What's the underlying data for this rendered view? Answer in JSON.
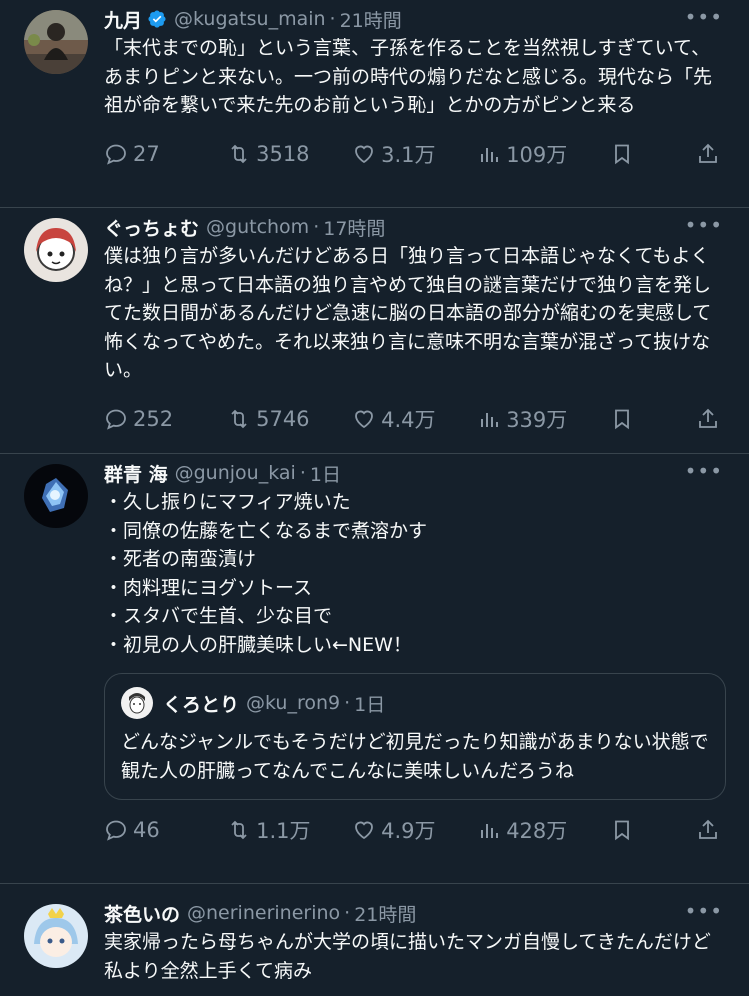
{
  "tweets": [
    {
      "name": "九月",
      "handle": "@kugatsu_main",
      "time": "21時間",
      "text": "「末代までの恥」という言葉、子孫を作ることを当然視しすぎていて、あまりピンと来ない。一つ前の時代の煽りだなと感じる。現代なら「先祖が命を繋いで来た先のお前という恥」とかの方がピンと来る",
      "replies": "27",
      "retweets": "3518",
      "likes": "3.1万",
      "views": "109万"
    },
    {
      "name": "ぐっちょむ",
      "handle": "@gutchom",
      "time": "17時間",
      "text": "僕は独り言が多いんだけどある日「独り言って日本語じゃなくてもよくね？」と思って日本語の独り言やめて独自の謎言葉だけで独り言を発してた数日間があるんだけど急速に脳の日本語の部分が縮むのを実感して怖くなってやめた。それ以来独り言に意味不明な言葉が混ざって抜けない。",
      "replies": "252",
      "retweets": "5746",
      "likes": "4.4万",
      "views": "339万"
    },
    {
      "name": "群青 海",
      "handle": "@gunjou_kai",
      "time": "1日",
      "text": "・久し振りにマフィア焼いた\n・同僚の佐藤を亡くなるまで煮溶かす\n・死者の南蛮漬け\n・肉料理にヨグソトース\n・スタバで生首、少な目で\n・初見の人の肝臓美味しい←NEW！",
      "quote": {
        "name": "くろとり",
        "handle": "@ku_ron9",
        "time": "1日",
        "text": "どんなジャンルでもそうだけど初見だったり知識があまりない状態で観た人の肝臓ってなんでこんなに美味しいんだろうね"
      },
      "replies": "46",
      "retweets": "1.1万",
      "likes": "4.9万",
      "views": "428万"
    },
    {
      "name": "茶色いの",
      "handle": "@nerinerinerino",
      "time": "21時間",
      "text": "実家帰ったら母ちゃんが大学の頃に描いたマンガ自慢してきたんだけど私より全然上手くて病み"
    }
  ],
  "separator": "·",
  "more": "•••",
  "colors": {
    "background": "#15202b",
    "text": "#f7f9f9",
    "secondary": "#8b98a5",
    "border": "#38444d",
    "verified": "#1d9bf0"
  }
}
